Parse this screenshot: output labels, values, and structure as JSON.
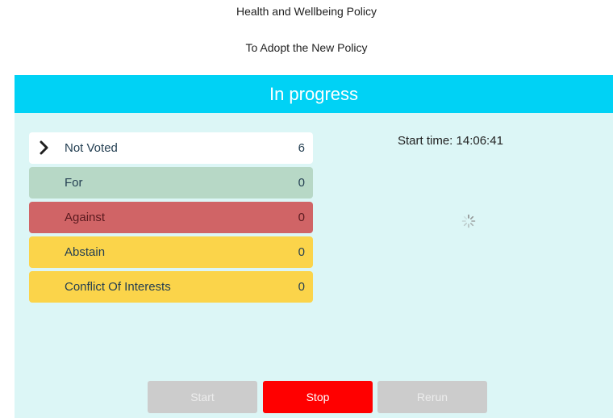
{
  "header": {
    "policy_title": "Health and Wellbeing Policy",
    "motion_title": "To Adopt the New Policy"
  },
  "status": {
    "label": "In progress",
    "color": "#00d2f5"
  },
  "tally": {
    "rows": [
      {
        "label": "Not Voted",
        "count": "6",
        "color": "#ffffff",
        "icon": "chevron-right-icon"
      },
      {
        "label": "For",
        "count": "0",
        "color": "#b7d8c6"
      },
      {
        "label": "Against",
        "count": "0",
        "color": "#d06466"
      },
      {
        "label": "Abstain",
        "count": "0",
        "color": "#fbd44a"
      },
      {
        "label": "Conflict Of Interests",
        "count": "0",
        "color": "#fbd44a"
      }
    ]
  },
  "timer": {
    "start_time_text": "Start time: 14:06:41",
    "icon": "loading-spinner-icon"
  },
  "controls": {
    "start_label": "Start",
    "stop_label": "Stop",
    "rerun_label": "Rerun",
    "stop_color": "#ff0000"
  }
}
